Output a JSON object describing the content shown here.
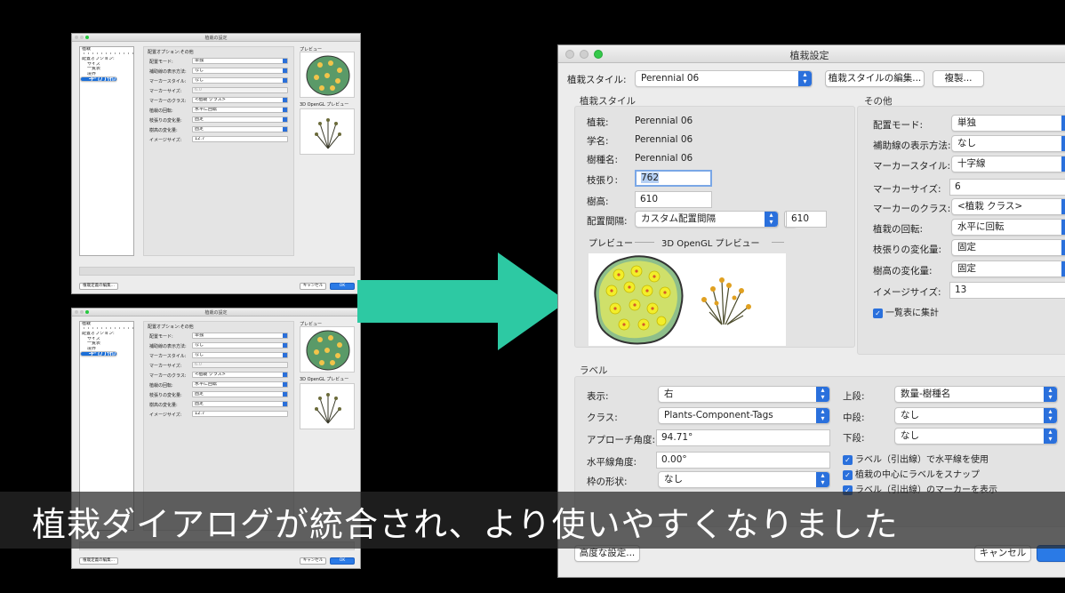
{
  "mini_top": {
    "title": "植栽の設定",
    "sidebar": [
      "植栽",
      "・・・・・・・・・・・・・・・・・・",
      "配置オプション:",
      "サイズ",
      "一覧表",
      "境界",
      "その他",
      "ラベル"
    ],
    "selected_index": 6,
    "section": "配置オプション:その他",
    "rows": [
      {
        "label": "配置モード:",
        "value": "単独"
      },
      {
        "label": "補助線の表示方法:",
        "value": "なし"
      },
      {
        "label": "マーカースタイル:",
        "value": "なし"
      },
      {
        "label": "マーカーサイズ:",
        "value": "6.0"
      },
      {
        "label": "マーカーのクラス:",
        "value": "<植栽 クラス>"
      },
      {
        "label": "植栽の回転:",
        "value": "水平に回転"
      },
      {
        "label": "枝張りの変化量:",
        "value": "固定"
      },
      {
        "label": "樹高の変化量:",
        "value": "固定"
      },
      {
        "label": "イメージサイズ:",
        "value": "12.7"
      }
    ],
    "preview_label": "プレビュー",
    "gl_label": "3D OpenGL プレビュー",
    "edit_button": "植栽定義の編集...",
    "cancel": "キャンセル",
    "ok": "OK"
  },
  "mini_bottom": {
    "title": "植栽の設定",
    "sidebar": [
      "植栽",
      "・・・・・・・・・・・・・・・・・・",
      "配置オプション:",
      "サイズ",
      "一覧表",
      "境界",
      "その他",
      "ラベル"
    ],
    "selected_index": 6,
    "section": "配置オプション:その他",
    "rows": [
      {
        "label": "配置モード:",
        "value": "単独"
      },
      {
        "label": "補助線の表示方法:",
        "value": "なし"
      },
      {
        "label": "マーカースタイル:",
        "value": "なし"
      },
      {
        "label": "マーカーサイズ:",
        "value": "6.0"
      },
      {
        "label": "マーカーのクラス:",
        "value": "<植栽 クラス>"
      },
      {
        "label": "植栽の回転:",
        "value": "水平に回転"
      },
      {
        "label": "枝張りの変化量:",
        "value": "固定"
      },
      {
        "label": "樹高の変化量:",
        "value": "固定"
      },
      {
        "label": "イメージサイズ:",
        "value": "12.7"
      }
    ],
    "preview_label": "プレビュー",
    "gl_label": "3D OpenGL プレビュー",
    "edit_button": "植栽定義の編集...",
    "cancel": "キャンセル",
    "ok": "OK"
  },
  "main": {
    "title": "植栽設定",
    "style_label": "植栽スタイル:",
    "style_value": "Perennial 06",
    "edit_style_button": "植栽スタイルの編集...",
    "duplicate_button": "複製...",
    "style_group": {
      "title": "植栽スタイル",
      "plant_label": "植栽:",
      "plant_value": "Perennial 06",
      "latin_label": "学名:",
      "latin_value": "Perennial 06",
      "species_label": "樹種名:",
      "species_value": "Perennial 06",
      "spread_label": "枝張り:",
      "spread_value": "762",
      "height_label": "樹高:",
      "height_value": "610",
      "spacing_label": "配置間隔:",
      "spacing_value": "カスタム配置間隔",
      "spacing_num": "610",
      "preview_label": "プレビュー",
      "gl_label": "3D OpenGL プレビュー"
    },
    "other_group": {
      "title": "その他",
      "rows": [
        {
          "label": "配置モード:",
          "value": "単独"
        },
        {
          "label": "補助線の表示方法:",
          "value": "なし"
        },
        {
          "label": "マーカースタイル:",
          "value": "十字線"
        },
        {
          "label": "マーカーサイズ:",
          "value": "6"
        },
        {
          "label": "マーカーのクラス:",
          "value": "<植栽 クラス>"
        },
        {
          "label": "植栽の回転:",
          "value": "水平に回転"
        },
        {
          "label": "枝張りの変化量:",
          "value": "固定"
        },
        {
          "label": "樹高の変化量:",
          "value": "固定"
        },
        {
          "label": "イメージサイズ:",
          "value": "13"
        }
      ],
      "schedule_check": "一覧表に集計"
    },
    "label_group": {
      "title": "ラベル",
      "display_label": "表示:",
      "display_value": "右",
      "class_label": "クラス:",
      "class_value": "Plants-Component-Tags",
      "approach_label": "アプローチ角度:",
      "approach_value": "94.71°",
      "horiz_label": "水平線角度:",
      "horiz_value": "0.00°",
      "frame_label": "枠の形状:",
      "frame_value": "なし",
      "upper_label": "上段:",
      "upper_value": "数量-樹種名",
      "middle_label": "中段:",
      "middle_value": "なし",
      "lower_label": "下段:",
      "lower_value": "なし",
      "check1": "ラベル（引出線）で水平線を使用",
      "check2": "植栽の中心にラベルをスナップ",
      "check3": "ラベル（引出線）のマーカーを表示"
    },
    "advanced_button": "高度な設定...",
    "cancel": "キャンセル"
  },
  "caption": "植栽ダイアログが統合され、より使いやすくなりました",
  "colors": {
    "arrow": "#2dc9a3",
    "accent": "#2a70dc",
    "caption_bg": "#282828"
  }
}
